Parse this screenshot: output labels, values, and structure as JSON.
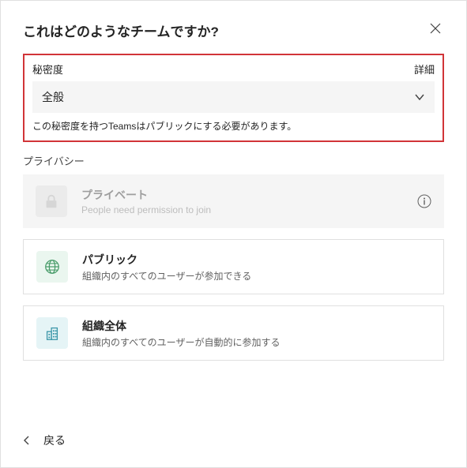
{
  "dialog": {
    "title": "これはどのようなチームですか?"
  },
  "sensitivity": {
    "label": "秘密度",
    "detailsLink": "詳細",
    "selectedValue": "全般",
    "hint": "この秘密度を持つTeamsはパブリックにする必要があります。"
  },
  "privacy": {
    "label": "プライバシー",
    "options": {
      "private": {
        "title": "プライベート",
        "desc": "People need permission to join"
      },
      "public": {
        "title": "パブリック",
        "desc": "組織内のすべてのユーザーが参加できる"
      },
      "org": {
        "title": "組織全体",
        "desc": "組織内のすべてのユーザーが自動的に参加する"
      }
    }
  },
  "footer": {
    "backLabel": "戻る"
  }
}
